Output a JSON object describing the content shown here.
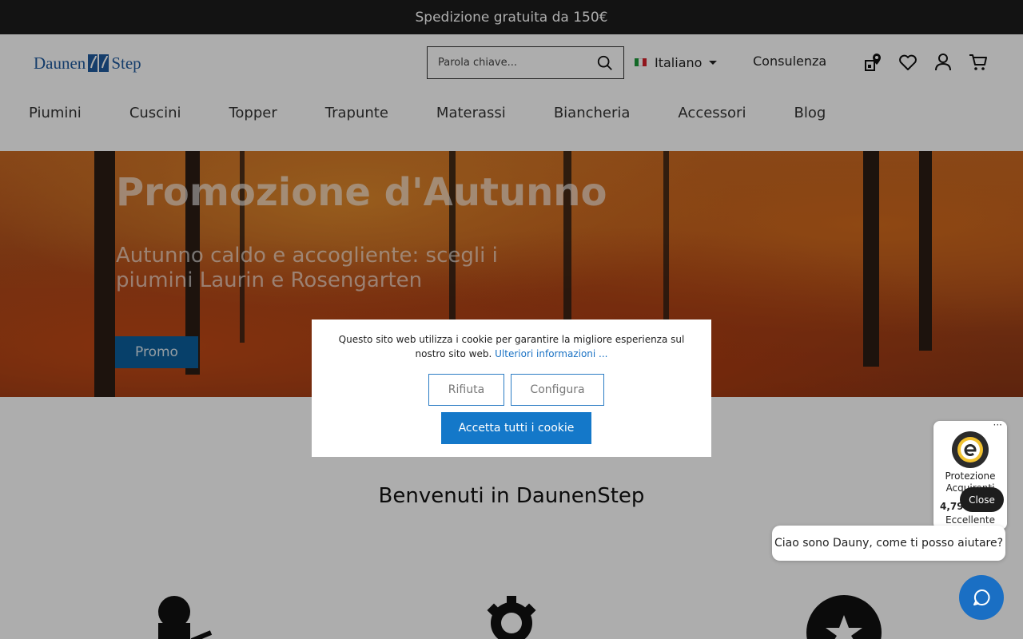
{
  "topbar": {
    "text": "Spedizione gratuita da 150€"
  },
  "header": {
    "logo": {
      "left": "Daunen",
      "right": "Step"
    },
    "search": {
      "placeholder": "Parola chiave..."
    },
    "language": {
      "label": "Italiano"
    },
    "consulenza": "Consulenza"
  },
  "nav": {
    "items": [
      "Piumini",
      "Cuscini",
      "Topper",
      "Trapunte",
      "Materassi",
      "Biancheria",
      "Accessori",
      "Blog"
    ]
  },
  "hero": {
    "title": "Promozione d'Autunno",
    "subtitle": "Autunno caldo e accogliente: scegli i piumini Laurin e Rosengarten",
    "button": "Promo"
  },
  "welcome": {
    "title": "Benvenuti in DaunenStep"
  },
  "cookie": {
    "message": "Questo sito web utilizza i cookie per garantire la migliore esperienza sul nostro sito web.",
    "more_link": "Ulteriori informazioni ...",
    "reject": "Rifiuta",
    "configure": "Configura",
    "accept": "Accetta tutti i cookie"
  },
  "trusted_shops": {
    "label": "Protezione Acquirenti",
    "score": "4,79",
    "rating": "Eccellente",
    "close": "Close",
    "dots": "···"
  },
  "chat": {
    "greeting": "Ciao sono Dauny, come ti posso aiutare?"
  },
  "colors": {
    "accent": "#1478c9",
    "topbar": "#1d1d1d"
  }
}
